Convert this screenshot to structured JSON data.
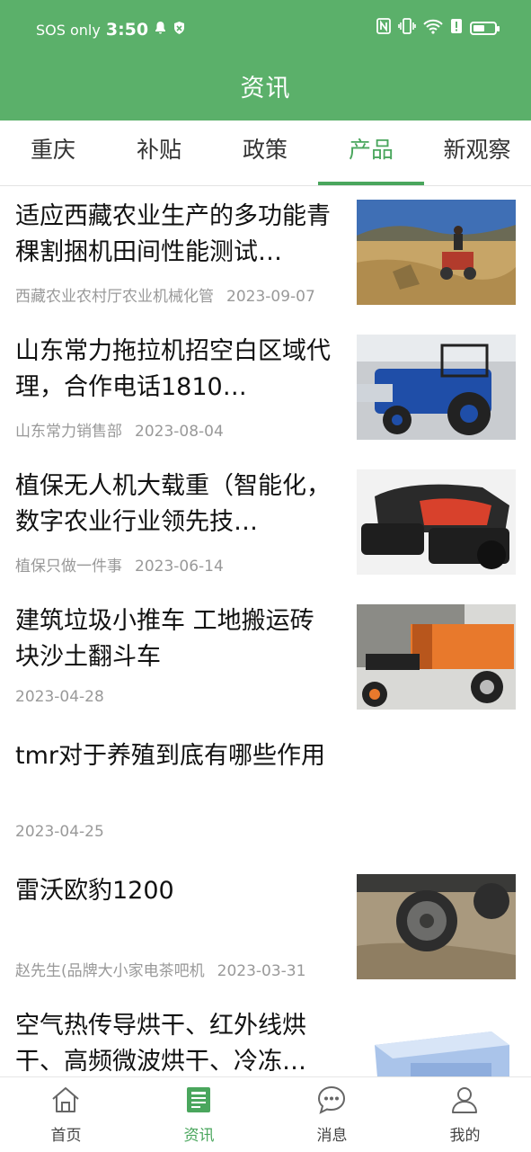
{
  "status_bar": {
    "carrier": "SOS only",
    "time": "3:50",
    "icons": [
      "bell-icon",
      "shield-icon",
      "nfc-icon",
      "vibrate-icon",
      "wifi-icon",
      "alert-icon",
      "battery-icon"
    ]
  },
  "header": {
    "title": "资讯"
  },
  "tabs": [
    {
      "label": "重庆"
    },
    {
      "label": "补贴"
    },
    {
      "label": "政策"
    },
    {
      "label": "产品",
      "active": true
    },
    {
      "label": "新观察"
    }
  ],
  "articles": [
    {
      "title": "适应西藏农业生产的多功能青稞割捆机田间性能测试…",
      "source": "西藏农业农村厅农业机械化管",
      "date": "2023-09-07",
      "thumb": "field-harvester-image"
    },
    {
      "title": "山东常力拖拉机招空白区域代理，合作电话1810…",
      "source": "山东常力销售部",
      "date": "2023-08-04",
      "thumb": "blue-tractor-image"
    },
    {
      "title": "植保无人机大载重（智能化，数字农业行业领先技…",
      "source": "植保只做一件事",
      "date": "2023-06-14",
      "thumb": "red-machine-image"
    },
    {
      "title": "建筑垃圾小推车 工地搬运砖块沙土翻斗车",
      "source": "",
      "date": "2023-04-28",
      "thumb": "orange-cart-image"
    },
    {
      "title": "tmr对于养殖到底有哪些作用",
      "source": "",
      "date": "2023-04-25",
      "thumb": ""
    },
    {
      "title": "雷沃欧豹1200",
      "source": "赵先生(品牌大小家电茶吧机",
      "date": "2023-03-31",
      "thumb": "tractor-wheel-image"
    },
    {
      "title": "空气热传导烘干、红外线烘干、高频微波烘干、冷冻…",
      "source": "",
      "date": "",
      "thumb": "dryer-machine-image"
    }
  ],
  "bottom_nav": [
    {
      "label": "首页",
      "icon": "home-icon"
    },
    {
      "label": "资讯",
      "icon": "news-icon",
      "active": true
    },
    {
      "label": "消息",
      "icon": "message-icon"
    },
    {
      "label": "我的",
      "icon": "profile-icon"
    }
  ],
  "colors": {
    "primary": "#5bb06a",
    "accent": "#4aa65d",
    "meta": "#999999"
  }
}
